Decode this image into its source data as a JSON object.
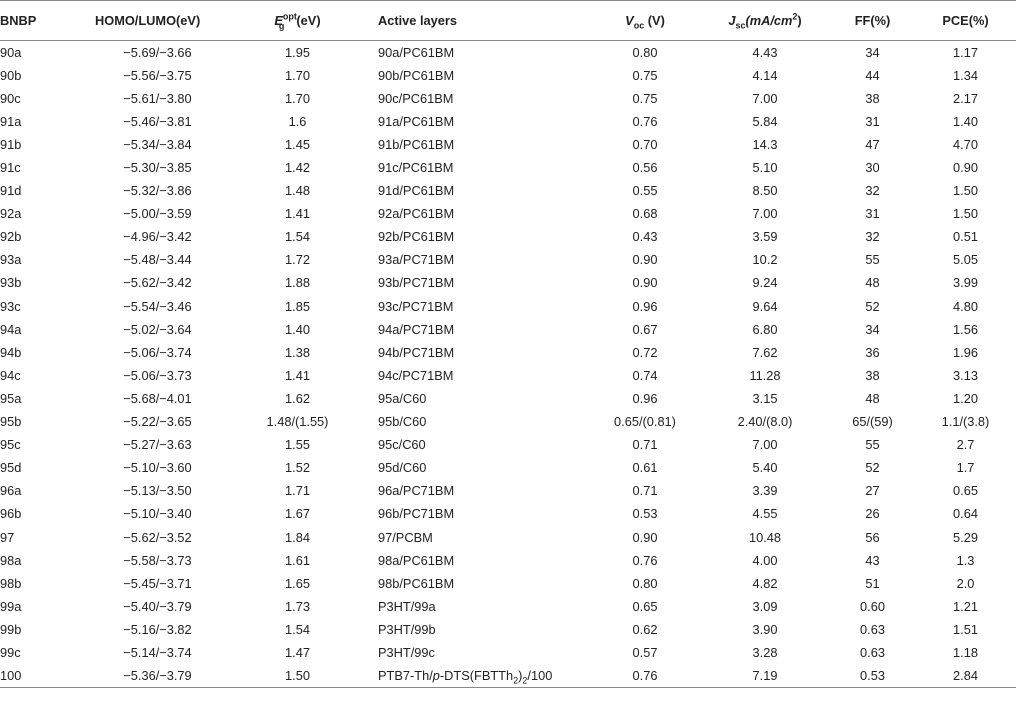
{
  "headers": {
    "bnbp": "BNBP",
    "homo_lumo": "HOMO/LUMO(eV)",
    "eg_main": "E",
    "eg_sup": "opt",
    "eg_sub": "g",
    "eg_unit": "(eV)",
    "active_layers": "Active layers",
    "voc_main": "V",
    "voc_sub": "oc",
    "voc_unit": " (V)",
    "jsc_main": "J",
    "jsc_sub": "sc",
    "jsc_unit": "(mA/cm",
    "jsc_sup": "2",
    "jsc_close": ")",
    "ff": "FF(%)",
    "pce": "PCE(%)"
  },
  "rows": [
    {
      "bnbp": "90a",
      "homo_lumo": "−5.69/−3.66",
      "eg": "1.95",
      "layer": "90a/PC61BM",
      "voc": "0.80",
      "jsc": "4.43",
      "ff": "34",
      "pce": "1.17"
    },
    {
      "bnbp": "90b",
      "homo_lumo": "−5.56/−3.75",
      "eg": "1.70",
      "layer": "90b/PC61BM",
      "voc": "0.75",
      "jsc": "4.14",
      "ff": "44",
      "pce": "1.34"
    },
    {
      "bnbp": "90c",
      "homo_lumo": "−5.61/−3.80",
      "eg": "1.70",
      "layer": "90c/PC61BM",
      "voc": "0.75",
      "jsc": "7.00",
      "ff": "38",
      "pce": "2.17"
    },
    {
      "bnbp": "91a",
      "homo_lumo": "−5.46/−3.81",
      "eg": "1.6",
      "layer": "91a/PC61BM",
      "voc": "0.76",
      "jsc": "5.84",
      "ff": "31",
      "pce": "1.40"
    },
    {
      "bnbp": "91b",
      "homo_lumo": "−5.34/−3.84",
      "eg": "1.45",
      "layer": "91b/PC61BM",
      "voc": "0.70",
      "jsc": "14.3",
      "ff": "47",
      "pce": "4.70"
    },
    {
      "bnbp": "91c",
      "homo_lumo": "−5.30/−3.85",
      "eg": "1.42",
      "layer": "91c/PC61BM",
      "voc": "0.56",
      "jsc": "5.10",
      "ff": "30",
      "pce": "0.90"
    },
    {
      "bnbp": "91d",
      "homo_lumo": "−5.32/−3.86",
      "eg": "1.48",
      "layer": "91d/PC61BM",
      "voc": "0.55",
      "jsc": "8.50",
      "ff": "32",
      "pce": "1.50"
    },
    {
      "bnbp": "92a",
      "homo_lumo": "−5.00/−3.59",
      "eg": "1.41",
      "layer": "92a/PC61BM",
      "voc": "0.68",
      "jsc": "7.00",
      "ff": "31",
      "pce": "1.50"
    },
    {
      "bnbp": "92b",
      "homo_lumo": "−4.96/−3.42",
      "eg": "1.54",
      "layer": "92b/PC61BM",
      "voc": "0.43",
      "jsc": "3.59",
      "ff": "32",
      "pce": "0.51"
    },
    {
      "bnbp": "93a",
      "homo_lumo": "−5.48/−3.44",
      "eg": "1.72",
      "layer": "93a/PC71BM",
      "voc": "0.90",
      "jsc": "10.2",
      "ff": "55",
      "pce": "5.05"
    },
    {
      "bnbp": "93b",
      "homo_lumo": "−5.62/−3.42",
      "eg": "1.88",
      "layer": "93b/PC71BM",
      "voc": "0.90",
      "jsc": "9.24",
      "ff": "48",
      "pce": "3.99"
    },
    {
      "bnbp": "93c",
      "homo_lumo": "−5.54/−3.46",
      "eg": "1.85",
      "layer": "93c/PC71BM",
      "voc": "0.96",
      "jsc": "9.64",
      "ff": "52",
      "pce": "4.80"
    },
    {
      "bnbp": "94a",
      "homo_lumo": "−5.02/−3.64",
      "eg": "1.40",
      "layer": "94a/PC71BM",
      "voc": "0.67",
      "jsc": "6.80",
      "ff": "34",
      "pce": "1.56"
    },
    {
      "bnbp": "94b",
      "homo_lumo": "−5.06/−3.74",
      "eg": "1.38",
      "layer": "94b/PC71BM",
      "voc": "0.72",
      "jsc": "7.62",
      "ff": "36",
      "pce": "1.96"
    },
    {
      "bnbp": "94c",
      "homo_lumo": "−5.06/−3.73",
      "eg": "1.41",
      "layer": "94c/PC71BM",
      "voc": "0.74",
      "jsc": "11.28",
      "ff": "38",
      "pce": "3.13"
    },
    {
      "bnbp": "95a",
      "homo_lumo": "−5.68/−4.01",
      "eg": "1.62",
      "layer": "95a/C60",
      "voc": "0.96",
      "jsc": "3.15",
      "ff": "48",
      "pce": "1.20"
    },
    {
      "bnbp": "95b",
      "homo_lumo": "−5.22/−3.65",
      "eg": "1.48/(1.55)",
      "layer": "95b/C60",
      "voc": "0.65/(0.81)",
      "jsc": "2.40/(8.0)",
      "ff": "65/(59)",
      "pce": "1.1/(3.8)"
    },
    {
      "bnbp": "95c",
      "homo_lumo": "−5.27/−3.63",
      "eg": "1.55",
      "layer": "95c/C60",
      "voc": "0.71",
      "jsc": "7.00",
      "ff": "55",
      "pce": "2.7"
    },
    {
      "bnbp": "95d",
      "homo_lumo": "−5.10/−3.60",
      "eg": "1.52",
      "layer": "95d/C60",
      "voc": "0.61",
      "jsc": "5.40",
      "ff": "52",
      "pce": "1.7"
    },
    {
      "bnbp": "96a",
      "homo_lumo": "−5.13/−3.50",
      "eg": "1.71",
      "layer": "96a/PC71BM",
      "voc": "0.71",
      "jsc": "3.39",
      "ff": "27",
      "pce": "0.65"
    },
    {
      "bnbp": "96b",
      "homo_lumo": "−5.10/−3.40",
      "eg": "1.67",
      "layer": "96b/PC71BM",
      "voc": "0.53",
      "jsc": "4.55",
      "ff": "26",
      "pce": "0.64"
    },
    {
      "bnbp": "97",
      "homo_lumo": "−5.62/−3.52",
      "eg": "1.84",
      "layer": "97/PCBM",
      "voc": "0.90",
      "jsc": "10.48",
      "ff": "56",
      "pce": "5.29"
    },
    {
      "bnbp": "98a",
      "homo_lumo": "−5.58/−3.73",
      "eg": "1.61",
      "layer": "98a/PC61BM",
      "voc": "0.76",
      "jsc": "4.00",
      "ff": "43",
      "pce": "1.3"
    },
    {
      "bnbp": "98b",
      "homo_lumo": "−5.45/−3.71",
      "eg": "1.65",
      "layer": "98b/PC61BM",
      "voc": "0.80",
      "jsc": "4.82",
      "ff": "51",
      "pce": "2.0"
    },
    {
      "bnbp": "99a",
      "homo_lumo": "−5.40/−3.79",
      "eg": "1.73",
      "layer": "P3HT/99a",
      "voc": "0.65",
      "jsc": "3.09",
      "ff": "0.60",
      "pce": "1.21"
    },
    {
      "bnbp": "99b",
      "homo_lumo": "−5.16/−3.82",
      "eg": "1.54",
      "layer": "P3HT/99b",
      "voc": "0.62",
      "jsc": "3.90",
      "ff": "0.63",
      "pce": "1.51"
    },
    {
      "bnbp": "99c",
      "homo_lumo": "−5.14/−3.74",
      "eg": "1.47",
      "layer": "P3HT/99c",
      "voc": "0.57",
      "jsc": "3.28",
      "ff": "0.63",
      "pce": "1.18"
    },
    {
      "bnbp": "100",
      "homo_lumo": "−5.36/−3.79",
      "eg": "1.50",
      "layer_parts": {
        "a": "PTB7-Th/",
        "b": "p",
        "c": "-DTS(FBTTh",
        "d": "2",
        "e": ")",
        "f": "2",
        "g": "/100"
      },
      "voc": "0.76",
      "jsc": "7.19",
      "ff": "0.53",
      "pce": "2.84"
    }
  ]
}
